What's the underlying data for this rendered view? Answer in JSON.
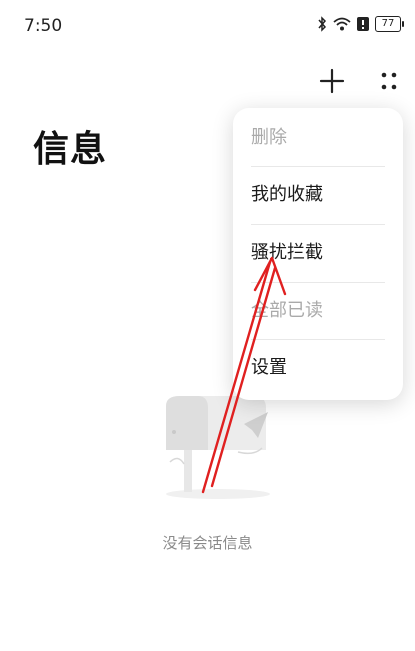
{
  "status_bar": {
    "time": "7:50",
    "battery": "77",
    "icons": [
      "bluetooth-icon",
      "wifi-icon",
      "alert-icon",
      "battery-icon"
    ]
  },
  "toolbar": {
    "icons": [
      "plus-icon",
      "more-dots-icon"
    ]
  },
  "page": {
    "title": "信息"
  },
  "menu": {
    "items": [
      {
        "label": "删除",
        "enabled": false
      },
      {
        "label": "我的收藏",
        "enabled": true
      },
      {
        "label": "骚扰拦截",
        "enabled": true
      },
      {
        "label": "全部已读",
        "enabled": false
      },
      {
        "label": "设置",
        "enabled": true
      }
    ]
  },
  "empty_state": {
    "text": "没有会话信息",
    "icon": "mailbox-icon"
  },
  "colors": {
    "annotation_arrow": "#e02020",
    "disabled_text": "#aaaaaa",
    "background": "#ffffff"
  }
}
